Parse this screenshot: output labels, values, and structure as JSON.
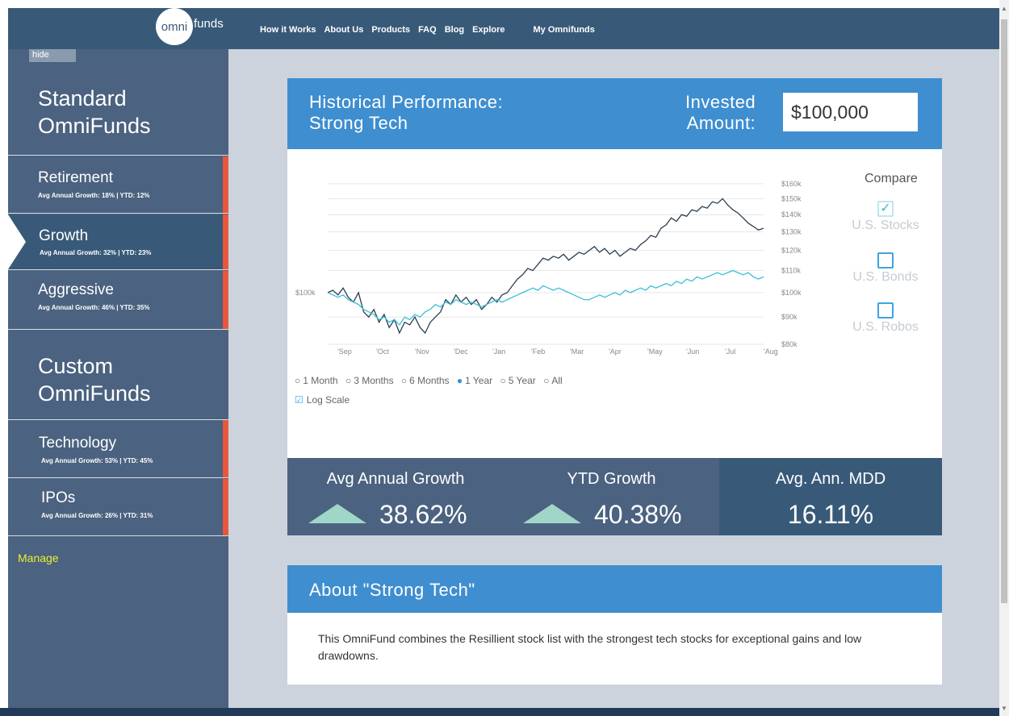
{
  "nav": {
    "logo_circle": "omni",
    "logo_rest": "funds",
    "links": [
      "How it Works",
      "About Us",
      "Products",
      "FAQ",
      "Blog",
      "Explore"
    ],
    "my_link": "My Omnifunds"
  },
  "sidebar": {
    "hide_label": "hide",
    "standard_title_1": "Standard",
    "standard_title_2": "OmniFunds",
    "standard_funds": [
      {
        "name": "Retirement",
        "stats": "Avg Annual Growth: 18% | YTD: 12%"
      },
      {
        "name": "Growth",
        "stats": "Avg Annual Growth:  32% | YTD: 23%"
      },
      {
        "name": "Aggressive",
        "stats": "Avg Annual Growth:  46% | YTD: 35%"
      }
    ],
    "custom_title_1": "Custom",
    "custom_title_2": "OmniFunds",
    "custom_funds": [
      {
        "name": "Technology",
        "stats": "Avg Annual Growth:  53% | YTD: 45%"
      },
      {
        "name": "IPOs",
        "stats": "Avg Annual Growth:  26% | YTD: 31%"
      }
    ],
    "manage_label": "Manage"
  },
  "performance": {
    "title_line1": "Historical Performance:",
    "title_line2": "Strong Tech",
    "invested_line1": "Invested",
    "invested_line2": "Amount:",
    "invested_value": "$100,000"
  },
  "compare": {
    "title": "Compare",
    "options": [
      {
        "label": "U.S. Stocks",
        "checked": true
      },
      {
        "label": "U.S. Bonds",
        "checked": false
      },
      {
        "label": "U.S. Robos",
        "checked": false
      }
    ]
  },
  "ranges": {
    "options": [
      "1 Month",
      "3 Months",
      "6 Months",
      "1 Year",
      "5 Year",
      "All"
    ],
    "selected": "1 Year",
    "log_scale_label": "Log Scale",
    "log_scale_checked": true
  },
  "stats": [
    {
      "label": "Avg Annual Growth",
      "value": "38.62%",
      "arrow": "up"
    },
    {
      "label": "YTD Growth",
      "value": "40.38%",
      "arrow": "up"
    },
    {
      "label": "Avg. Ann. MDD",
      "value": "16.11%",
      "arrow": "none"
    }
  ],
  "about": {
    "title": "About \"Strong Tech\"",
    "text": "This OmniFund combines the Resillient stock list with the strongest tech stocks for exceptional gains and low drawdowns."
  },
  "chart_data": {
    "type": "line",
    "log_scale": true,
    "start_label": "$100k",
    "y_ticks": [
      "$80k",
      "$90k",
      "$100k",
      "$110k",
      "$120k",
      "$130k",
      "$140k",
      "$150k",
      "$160k"
    ],
    "y_tick_values": [
      80,
      90,
      100,
      110,
      120,
      130,
      140,
      150,
      160
    ],
    "x_ticks": [
      "'Sep",
      "'Oct",
      "'Nov",
      "'Dec",
      "'Jan",
      "'Feb",
      "'Mar",
      "'Apr",
      "'May",
      "'Jun",
      "'Jul",
      "'Aug"
    ],
    "ylim": [
      80,
      165
    ],
    "grid": true,
    "colors": {
      "fund": "#2c3e50",
      "stocks": "#3bbfd8"
    },
    "series": [
      {
        "key": "fund",
        "values": [
          100,
          101,
          99,
          102,
          98,
          96,
          100,
          92,
          90,
          93,
          88,
          91,
          86,
          89,
          84,
          88,
          87,
          90,
          86,
          84,
          88,
          90,
          92,
          97,
          95,
          99,
          96,
          98,
          95,
          97,
          93,
          95,
          98,
          96,
          99,
          100,
          103,
          106,
          108,
          111,
          110,
          113,
          116,
          115,
          117,
          116,
          118,
          115,
          117,
          119,
          118,
          120,
          122,
          119,
          121,
          118,
          120,
          117,
          119,
          121,
          120,
          123,
          125,
          128,
          127,
          132,
          134,
          138,
          136,
          140,
          139,
          143,
          142,
          145,
          144,
          148,
          147,
          150,
          146,
          143,
          141,
          138,
          135,
          133,
          131,
          132
        ]
      },
      {
        "key": "stocks",
        "values": [
          100,
          99,
          98,
          99,
          97,
          96,
          95,
          93,
          92,
          91,
          89,
          90,
          88,
          89,
          87,
          90,
          89,
          91,
          90,
          92,
          93,
          95,
          94,
          96,
          95,
          97,
          96,
          95,
          96,
          95,
          94,
          95,
          96,
          97,
          96,
          97,
          98,
          99,
          100,
          101,
          102,
          101,
          103,
          102,
          101,
          102,
          101,
          100,
          99,
          98,
          97,
          97,
          98,
          99,
          98,
          99,
          100,
          99,
          101,
          100,
          101,
          102,
          101,
          103,
          102,
          103,
          104,
          103,
          105,
          104,
          106,
          105,
          107,
          106,
          107,
          108,
          109,
          108,
          109,
          110,
          109,
          108,
          109,
          107,
          106,
          107
        ]
      }
    ]
  }
}
